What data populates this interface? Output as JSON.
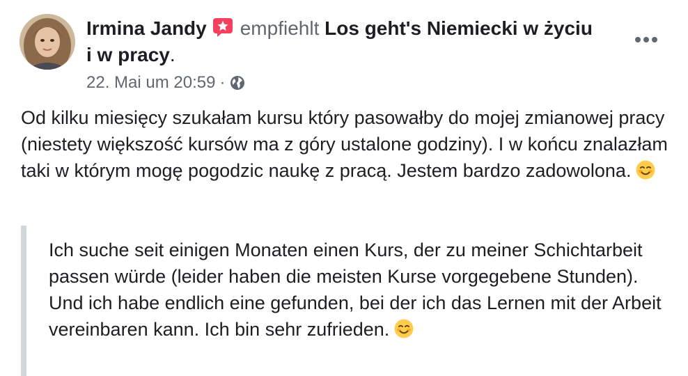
{
  "author": {
    "name": "Irmina Jandy",
    "badge_icon": "recommend-star-icon",
    "verb": "empfiehlt",
    "page": "Los geht's Niemiecki w życiu i w pracy",
    "period": "."
  },
  "meta": {
    "timestamp": "22. Mai um 20:59",
    "separator": "·",
    "privacy_icon": "globe-icon"
  },
  "more_icon": "more-options-icon",
  "post": {
    "text": "Od kilku miesięcy szukałam kursu który pasowałby do mojej zmianowej pracy (niestety większość kursów ma z góry ustalone godziny). I w końcu znalazłam taki w którym mogę pogodzic naukę z pracą. Jestem bardzo zadowolona.",
    "emoji": "smiling-face-icon"
  },
  "translation": {
    "text": "Ich suche seit einigen Monaten einen Kurs, der zu meiner Schichtarbeit passen würde (leider haben die meisten Kurse vorgegebene Stunden). Und ich habe endlich eine gefunden, bei der ich das Lernen mit der Arbeit vereinbaren kann. Ich bin sehr zufrieden.",
    "emoji": "smiling-face-icon"
  },
  "colors": {
    "badge": "#f3425f",
    "secondary_text": "#606770",
    "quote_bar": "#d3d6db"
  }
}
